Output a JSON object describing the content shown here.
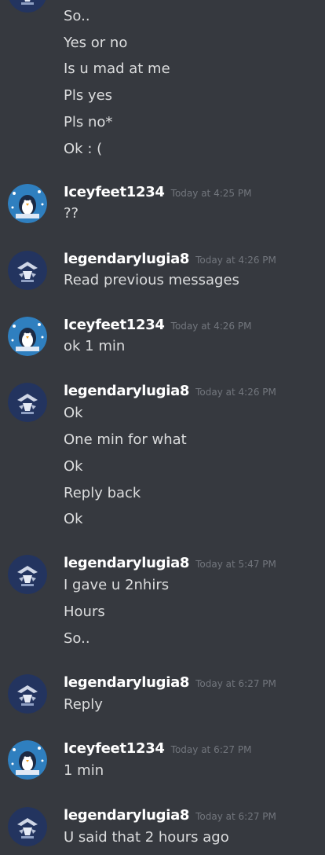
{
  "chat": {
    "top_messages": [
      "So..",
      "Yes or no",
      "Is u mad at me",
      "Pls yes",
      "Pls no*",
      "Ok : ("
    ],
    "groups": [
      {
        "author": "Iceyfeet1234",
        "timestamp": "Today at 4:25 PM",
        "messages": [
          "??"
        ]
      },
      {
        "author": "legendarylugia8",
        "timestamp": "Today at 4:26 PM",
        "messages": [
          "Read previous messages"
        ]
      },
      {
        "author": "Iceyfeet1234",
        "timestamp": "Today at 4:26 PM",
        "messages": [
          "ok 1 min"
        ]
      },
      {
        "author": "legendarylugia8",
        "timestamp": "Today at 4:26 PM",
        "messages": [
          "Ok",
          "One min for what",
          "Ok",
          "Reply back",
          "Ok"
        ]
      },
      {
        "author": "legendarylugia8",
        "timestamp": "Today at 5:47 PM",
        "messages": [
          "I gave u 2nhirs",
          "Hours",
          "So.."
        ]
      },
      {
        "author": "legendarylugia8",
        "timestamp": "Today at 6:27 PM",
        "messages": [
          "Reply"
        ]
      },
      {
        "author": "Iceyfeet1234",
        "timestamp": "Today at 6:27 PM",
        "messages": [
          "1 min"
        ]
      },
      {
        "author": "legendarylugia8",
        "timestamp": "Today at 6:27 PM",
        "messages": [
          "U said that 2 hours ago"
        ]
      }
    ]
  },
  "colors": {
    "background": "#36393f",
    "author": "#ffffff",
    "message_text": "#dcddde",
    "timestamp": "#72767d",
    "lugia_avatar_bg": "#23345f",
    "icey_avatar_bg": "#2f7fbf"
  },
  "icons": {
    "legendarylugia8": "lugia-avatar-icon",
    "Iceyfeet1234": "penguin-avatar-icon"
  }
}
